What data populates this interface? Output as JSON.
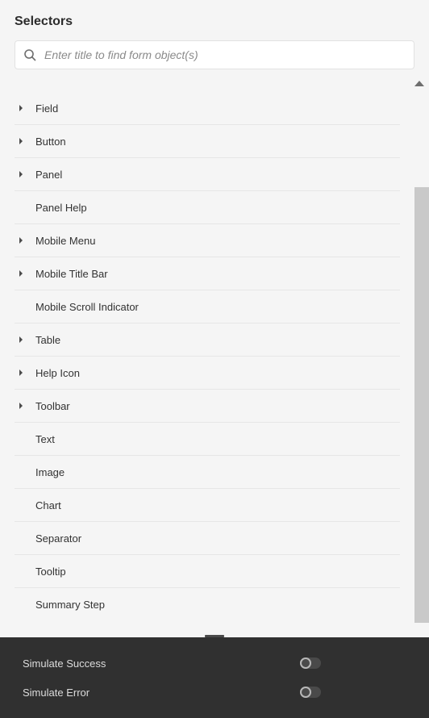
{
  "header": {
    "title": "Selectors"
  },
  "search": {
    "placeholder": "Enter title to find form object(s)"
  },
  "items": [
    {
      "label": "Field",
      "expandable": true
    },
    {
      "label": "Button",
      "expandable": true
    },
    {
      "label": "Panel",
      "expandable": true
    },
    {
      "label": "Panel Help",
      "expandable": false
    },
    {
      "label": "Mobile Menu",
      "expandable": true
    },
    {
      "label": "Mobile Title Bar",
      "expandable": true
    },
    {
      "label": "Mobile Scroll Indicator",
      "expandable": false
    },
    {
      "label": "Table",
      "expandable": true
    },
    {
      "label": "Help Icon",
      "expandable": true
    },
    {
      "label": "Toolbar",
      "expandable": true
    },
    {
      "label": "Text",
      "expandable": false
    },
    {
      "label": "Image",
      "expandable": false
    },
    {
      "label": "Chart",
      "expandable": false
    },
    {
      "label": "Separator",
      "expandable": false
    },
    {
      "label": "Tooltip",
      "expandable": false
    },
    {
      "label": "Summary Step",
      "expandable": false
    }
  ],
  "footer": {
    "simulateSuccess": "Simulate Success",
    "simulateError": "Simulate Error"
  }
}
